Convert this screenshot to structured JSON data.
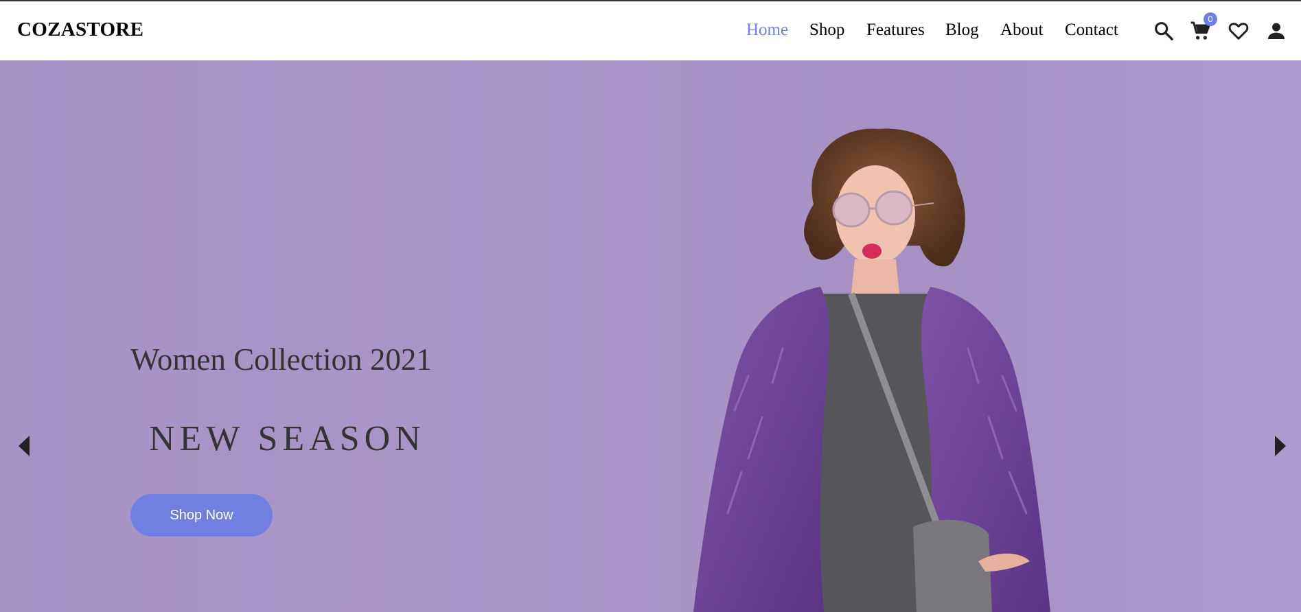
{
  "brand": {
    "logo_text": "COZASTORE"
  },
  "nav": {
    "items": [
      {
        "label": "Home",
        "active": true
      },
      {
        "label": "Shop",
        "active": false
      },
      {
        "label": "Features",
        "active": false
      },
      {
        "label": "Blog",
        "active": false
      },
      {
        "label": "About",
        "active": false
      },
      {
        "label": "Contact",
        "active": false
      }
    ]
  },
  "header_icons": {
    "search": "search-icon",
    "cart": "cart-icon",
    "cart_count": "0",
    "wishlist": "heart-icon",
    "account": "user-icon"
  },
  "hero": {
    "subtitle": "Women Collection 2021",
    "headline": "NEW SEASON",
    "cta_label": "Shop Now",
    "prev_icon": "caret-left-icon",
    "next_icon": "caret-right-icon"
  },
  "colors": {
    "accent": "#717fe0",
    "hero_background": "#a793c4",
    "text_dark": "#333333",
    "coat_purple": "#6e4596",
    "dress_gray": "#555559"
  }
}
